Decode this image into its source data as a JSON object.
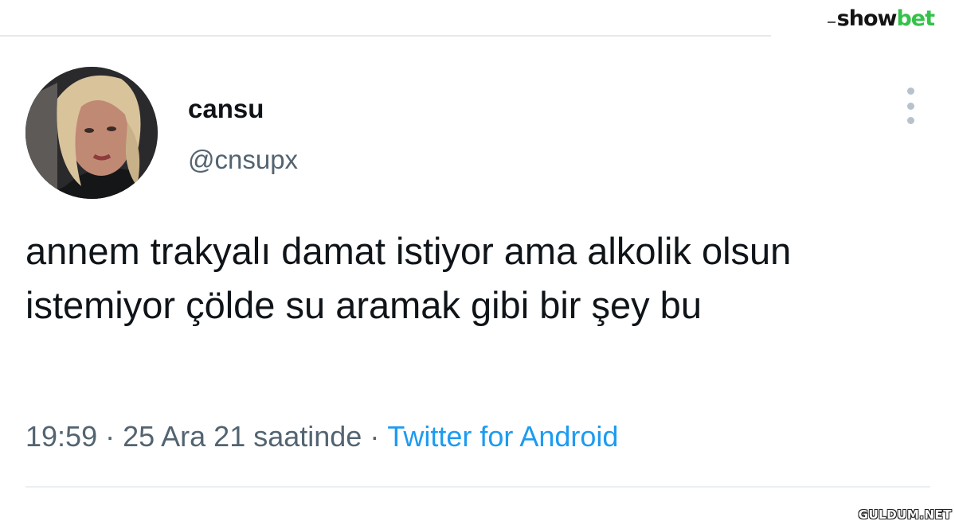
{
  "brand": {
    "show": "show",
    "bet": "bet"
  },
  "tweet": {
    "display_name": "cansu",
    "handle": "@cnsupx",
    "text": "annem trakyalı damat istiyor ama alkolik olsun istemiyor çölde su aramak gibi bir şey bu",
    "time": "19:59",
    "separator": "·",
    "date": "25 Ara 21 saatinde",
    "source": "Twitter for Android"
  },
  "watermark": {
    "text": "GULDUM.NET"
  },
  "icons": {
    "more": "more-vertical-icon"
  }
}
